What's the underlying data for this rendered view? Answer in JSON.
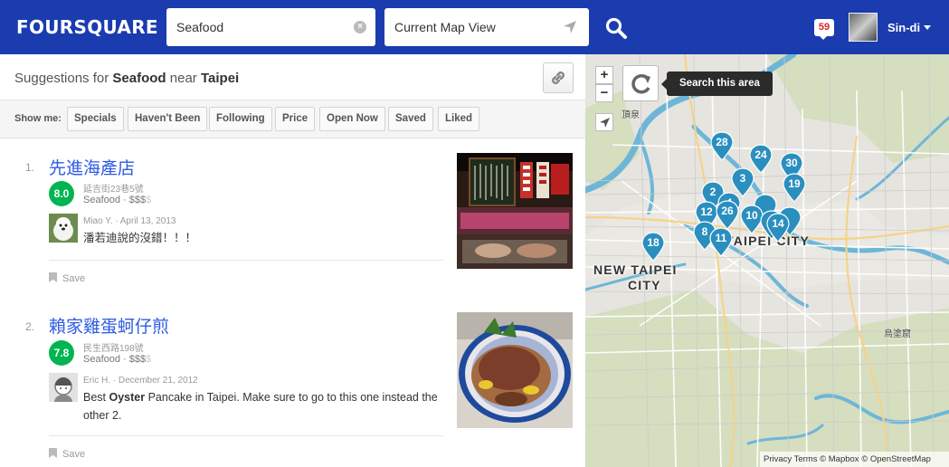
{
  "header": {
    "logo": "FOURSQUARE",
    "search_query": "Seafood",
    "near_value": "Current Map View",
    "notification_count": "59",
    "user_name": "Sin-di",
    "brand_color": "#1a3caf"
  },
  "suggestions": {
    "prefix": "Suggestions for",
    "query": "Seafood",
    "near_word": "near",
    "place": "Taipei"
  },
  "filters": {
    "label": "Show me:",
    "buttons": [
      "Specials",
      "Haven't Been",
      "Following",
      "Price",
      "Open Now",
      "Saved",
      "Liked"
    ]
  },
  "venues": [
    {
      "rank": "1.",
      "name": "先進海產店",
      "score": "8.0",
      "address": "延吉街23巷5號",
      "category": "Seafood",
      "price_active": "$$$",
      "price_inactive": "$",
      "tip_author": "Miao Y. · April 13, 2013",
      "tip_text": "潘若迪說的沒錯！！！",
      "save_label": "Save"
    },
    {
      "rank": "2.",
      "name": "賴家雞蛋蚵仔煎",
      "score": "7.8",
      "address": "民生西路198號",
      "category": "Seafood",
      "price_active": "$$$",
      "price_inactive": "$",
      "tip_author": "Eric H. · December 21, 2012",
      "tip_text_pre": "Best ",
      "tip_text_bold": "Oyster",
      "tip_text_post": " Pancake in Taipei. Make sure to go to this one instead the other 2.",
      "save_label": "Save"
    }
  ],
  "map": {
    "search_area_label": "Search this area",
    "zoom_in": "+",
    "zoom_out": "−",
    "label_taipei": "TAIPEI CITY",
    "label_new_taipei_1": "NEW TAIPEI",
    "label_new_taipei_2": "CITY",
    "label_dingshe": "頂泉",
    "label_wudu": "烏塗窟",
    "attribution": "Privacy  Terms  © Mapbox © OpenStreetMap",
    "pin_color": "#2a8fbf",
    "pins": [
      "28",
      "24",
      "30",
      "19",
      "2",
      "3",
      "4",
      "12",
      "26",
      "10",
      "14",
      "8",
      "11",
      "18"
    ]
  }
}
